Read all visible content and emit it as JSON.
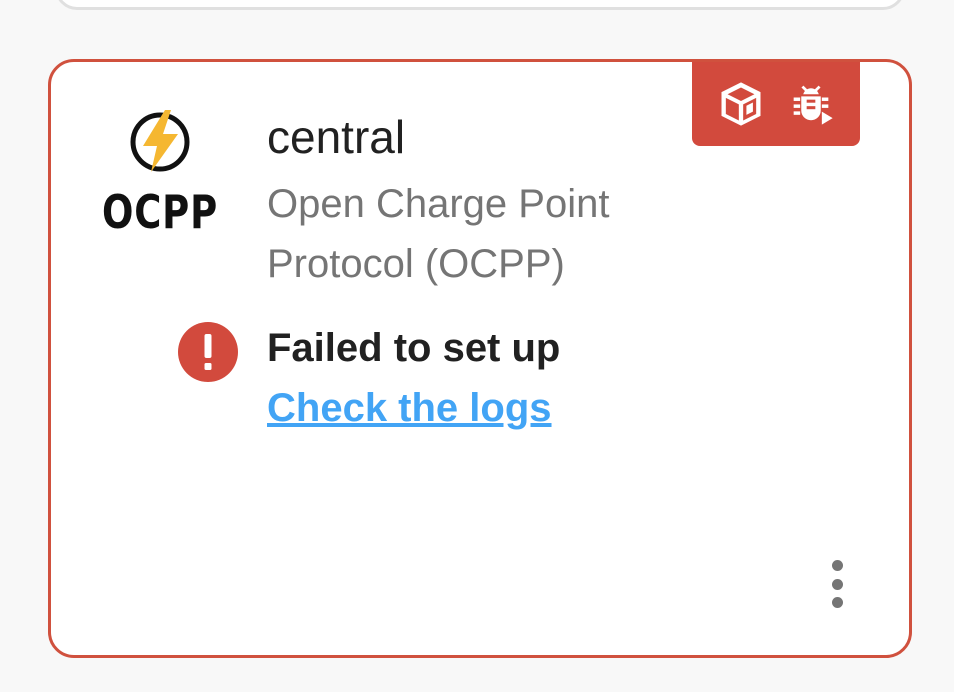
{
  "colors": {
    "error_accent": "#d24a3d",
    "link": "#42a4f5",
    "bolt": "#f5b731"
  },
  "integration": {
    "logo_text": "OCPP",
    "title": "central",
    "subtitle": "Open Charge Point Protocol (OCPP)"
  },
  "badges": [
    {
      "icon": "package-icon"
    },
    {
      "icon": "bug-play-icon"
    }
  ],
  "status": {
    "icon": "alert-circle-icon",
    "title": "Failed to set up",
    "link_label": "Check the logs"
  },
  "menu": {
    "icon": "dots-vertical-icon"
  }
}
